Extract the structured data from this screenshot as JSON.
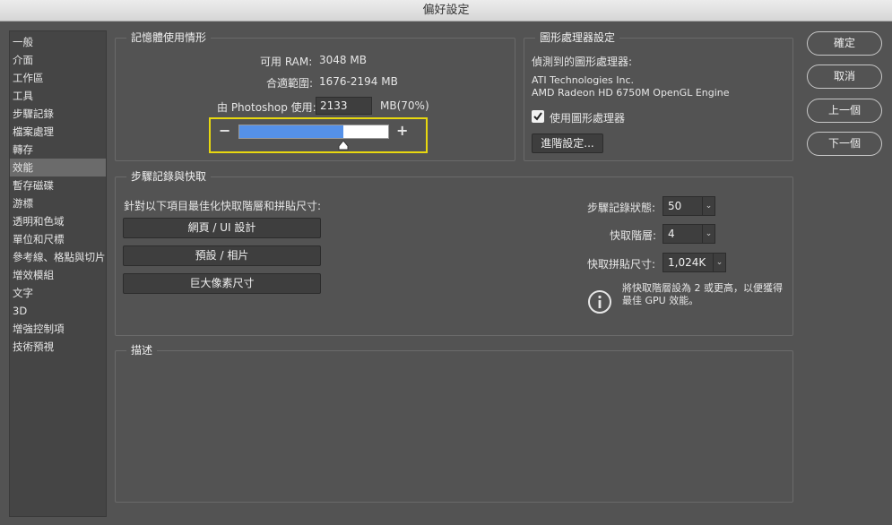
{
  "window": {
    "title": "偏好設定"
  },
  "sidebar": {
    "items": [
      {
        "label": "一般"
      },
      {
        "label": "介面"
      },
      {
        "label": "工作區"
      },
      {
        "label": "工具"
      },
      {
        "label": "步驟記錄"
      },
      {
        "label": "檔案處理"
      },
      {
        "label": "轉存"
      },
      {
        "label": "效能"
      },
      {
        "label": "暫存磁碟"
      },
      {
        "label": "游標"
      },
      {
        "label": "透明和色域"
      },
      {
        "label": "單位和尺標"
      },
      {
        "label": "參考線、格點與切片"
      },
      {
        "label": "增效模組"
      },
      {
        "label": "文字"
      },
      {
        "label": "3D"
      },
      {
        "label": "增強控制項"
      },
      {
        "label": "技術預視"
      }
    ],
    "selected": "效能"
  },
  "memory": {
    "title": "記憶體使用情形",
    "available_label": "可用 RAM:",
    "available_value": "3048 MB",
    "ideal_label": "合適範圍:",
    "ideal_value": "1676-2194 MB",
    "photoshop_label": "由 Photoshop 使用:",
    "photoshop_value": "2133",
    "photoshop_unit": "MB(70%)",
    "slider_fraction": 0.7,
    "minus": "−",
    "plus": "+"
  },
  "gpu": {
    "title": "圖形處理器設定",
    "detected_label": "偵測到的圖形處理器:",
    "vendor": "ATI Technologies Inc.",
    "renderer": "AMD Radeon HD 6750M OpenGL Engine",
    "use_gpu_label": "使用圖形處理器",
    "use_gpu_checked": true,
    "advanced_button": "進階設定..."
  },
  "history_cache": {
    "title": "步驟記錄與快取",
    "optimize_label": "針對以下項目最佳化快取階層和拼貼尺寸:",
    "presets": [
      "網頁 / UI 設計",
      "預設 / 相片",
      "巨大像素尺寸"
    ],
    "history_states_label": "步驟記錄狀態:",
    "history_states_value": "50",
    "cache_levels_label": "快取階層:",
    "cache_levels_value": "4",
    "tile_size_label": "快取拼貼尺寸:",
    "tile_size_value": "1,024K",
    "info_text_line1": "將快取階層設為 2 或更高，以便獲得",
    "info_text_line2": "最佳 GPU 效能。"
  },
  "description": {
    "title": "描述"
  },
  "buttons": {
    "ok": "確定",
    "cancel": "取消",
    "prev": "上一個",
    "next": "下一個"
  },
  "colors": {
    "accent_blue": "#5591e8",
    "highlight_yellow": "#e8d80f",
    "panel_bg": "#535353"
  }
}
